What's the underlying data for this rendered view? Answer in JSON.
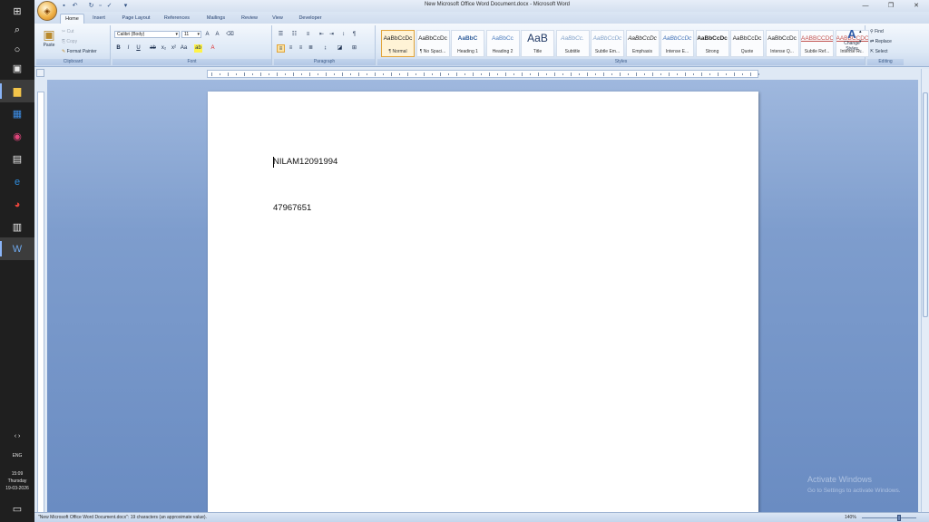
{
  "taskbar": {
    "language": "ENG",
    "time": "15:09",
    "day": "Thursday",
    "date": "19-03-2026"
  },
  "window": {
    "title": "New Microsoft Office Word Document.docx - Microsoft Word"
  },
  "tabs": [
    "Home",
    "Insert",
    "Page Layout",
    "References",
    "Mailings",
    "Review",
    "View",
    "Developer"
  ],
  "clipboard": {
    "paste_label": "Paste",
    "cut_label": "Cut",
    "copy_label": "Copy",
    "format_painter_label": "Format Painter",
    "group_label": "Clipboard"
  },
  "font": {
    "name": "Calibri (Body)",
    "size": "11",
    "group_label": "Font"
  },
  "paragraph": {
    "group_label": "Paragraph"
  },
  "styles": {
    "group_label": "Styles",
    "items": [
      {
        "sample": "AaBbCcDc",
        "name": "¶ Normal"
      },
      {
        "sample": "AaBbCcDc",
        "name": "¶ No Spaci..."
      },
      {
        "sample": "AaBbC",
        "name": "Heading 1"
      },
      {
        "sample": "AaBbCc",
        "name": "Heading 2"
      },
      {
        "sample": "AaB",
        "name": "Title"
      },
      {
        "sample": "AaBbCc.",
        "name": "Subtitle"
      },
      {
        "sample": "AaBbCcDc",
        "name": "Subtle Em..."
      },
      {
        "sample": "AaBbCcDc",
        "name": "Emphasis"
      },
      {
        "sample": "AaBbCcDc",
        "name": "Intense E..."
      },
      {
        "sample": "AaBbCcDc",
        "name": "Strong"
      },
      {
        "sample": "AaBbCcDc",
        "name": "Quote"
      },
      {
        "sample": "AaBbCcDc",
        "name": "Intense Q..."
      },
      {
        "sample": "AABBCCDC",
        "name": "Subtle Ref..."
      },
      {
        "sample": "AABBCCDC",
        "name": "Intense R..."
      }
    ],
    "change_styles_label": "Change Styles"
  },
  "editing": {
    "find_label": "Find",
    "replace_label": "Replace",
    "select_label": "Select",
    "group_label": "Editing"
  },
  "document": {
    "line1": "NILAM12091994",
    "line2": "47967651"
  },
  "watermark": {
    "title": "Activate Windows",
    "subtitle": "Go to Settings to activate Windows."
  },
  "status": {
    "text": "\"New Microsoft Office Word Document.docx\": 19 characters (an approximate value).",
    "zoom": "140%"
  }
}
